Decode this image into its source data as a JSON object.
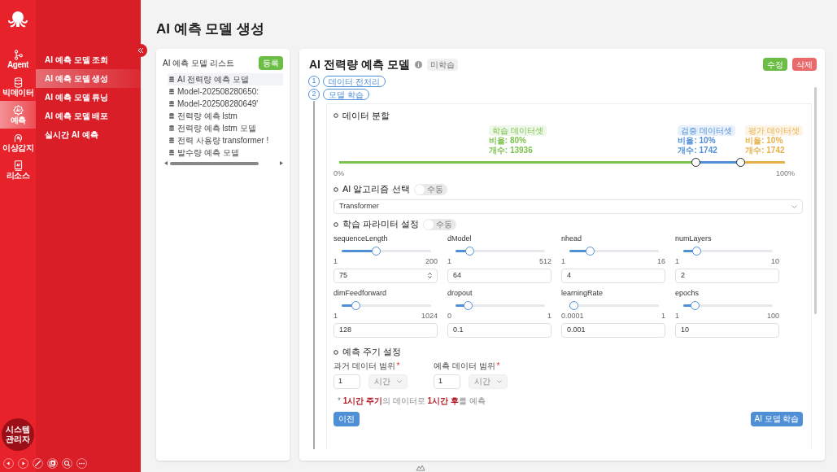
{
  "rail": {
    "items": [
      {
        "label": "Agent",
        "selected": false
      },
      {
        "label": "빅데이터",
        "selected": false
      },
      {
        "label": "예측",
        "selected": true
      },
      {
        "label": "이상감지",
        "selected": false
      },
      {
        "label": "리소스",
        "selected": false
      }
    ],
    "user_badge": "시스템\n관리자"
  },
  "submenu": [
    {
      "label": "AI 예측 모델 조회",
      "selected": false
    },
    {
      "label": "AI 예측 모델 생성",
      "selected": true
    },
    {
      "label": "AI 예측 모델 튜닝",
      "selected": false
    },
    {
      "label": "AI 예측 모델 배포",
      "selected": false
    },
    {
      "label": "실시간 AI 예측",
      "selected": false
    }
  ],
  "page_title": "AI 예측 모델 생성",
  "model_list": {
    "title": "AI 예측 모델 리스트",
    "add_button": "등록",
    "items": [
      {
        "label": "AI 전력량 예측 모델",
        "selected": true
      },
      {
        "label": "Model-202508280650:",
        "selected": false
      },
      {
        "label": "Model-202508280649'",
        "selected": false
      },
      {
        "label": "전력량 예측 lstm",
        "selected": false
      },
      {
        "label": "전력량 예측 lstm 모델",
        "selected": false
      },
      {
        "label": "전력 사용량 transformer !",
        "selected": false
      },
      {
        "label": "발수량 예측 모델",
        "selected": false
      }
    ]
  },
  "detail": {
    "title": "AI 전력량 예측 모델",
    "status_badge": "미학습",
    "edit_button": "수정",
    "delete_button": "삭제",
    "steps": [
      {
        "number": "1",
        "label": "데이터 전처리"
      },
      {
        "number": "2",
        "label": "모델 학습"
      }
    ],
    "split": {
      "heading": "데이터 분할",
      "min_label": "0%",
      "max_label": "100%",
      "handles": [
        {
          "level": 0.8
        },
        {
          "level": 0.9
        }
      ],
      "segments": [
        {
          "name": "학습 데이터셋",
          "ratio": "비율: 80%",
          "count": "개수: 13936",
          "color": "#7cc24f"
        },
        {
          "name": "검증 데이터셋",
          "ratio": "비율: 10%",
          "count": "개수: 1742",
          "color": "#4f8fd6"
        },
        {
          "name": "평가 데이터셋",
          "ratio": "비율: 10%",
          "count": "개수: 1742",
          "color": "#e8b04a"
        }
      ]
    },
    "algorithm": {
      "heading": "AI 알고리즘 선택",
      "toggle_label": "수동",
      "toggle_on": false,
      "value": "Transformer"
    },
    "params": {
      "heading": "학습 파라미터 설정",
      "toggle_label": "수동",
      "toggle_on": false,
      "items": [
        {
          "name": "sequenceLength",
          "min": "1",
          "max": "200",
          "value": "75",
          "level": 0.37,
          "spinner": true
        },
        {
          "name": "dModel",
          "min": "1",
          "max": "512",
          "value": "64",
          "level": 0.12,
          "spinner": false
        },
        {
          "name": "nhead",
          "min": "1",
          "max": "16",
          "value": "4",
          "level": 0.2,
          "spinner": false
        },
        {
          "name": "numLayers",
          "min": "1",
          "max": "10",
          "value": "2",
          "level": 0.11,
          "spinner": false
        },
        {
          "name": "dimFeedforward",
          "min": "1",
          "max": "1024",
          "value": "128",
          "level": 0.12,
          "spinner": false
        },
        {
          "name": "dropout",
          "min": "0",
          "max": "1",
          "value": "0.1",
          "level": 0.1,
          "spinner": false
        },
        {
          "name": "learningRate",
          "min": "0.0001",
          "max": "1",
          "value": "0.001",
          "level": 0.0,
          "spinner": false
        },
        {
          "name": "epochs",
          "min": "1",
          "max": "100",
          "value": "10",
          "level": 0.09,
          "spinner": false
        }
      ]
    },
    "cycle": {
      "heading": "예측 주기 설정",
      "fields": [
        {
          "label": "과거 데이터 범위",
          "required_mark": "*",
          "value": "1",
          "unit": "시간"
        },
        {
          "label": "예측 데이터 범위",
          "required_mark": "*",
          "value": "1",
          "unit": "시간"
        }
      ],
      "note": "* **1시간 주기**의 데이터로 **1시간 후**를 예측"
    },
    "prev_button": "이전",
    "train_button": "AI 모델 학습"
  }
}
